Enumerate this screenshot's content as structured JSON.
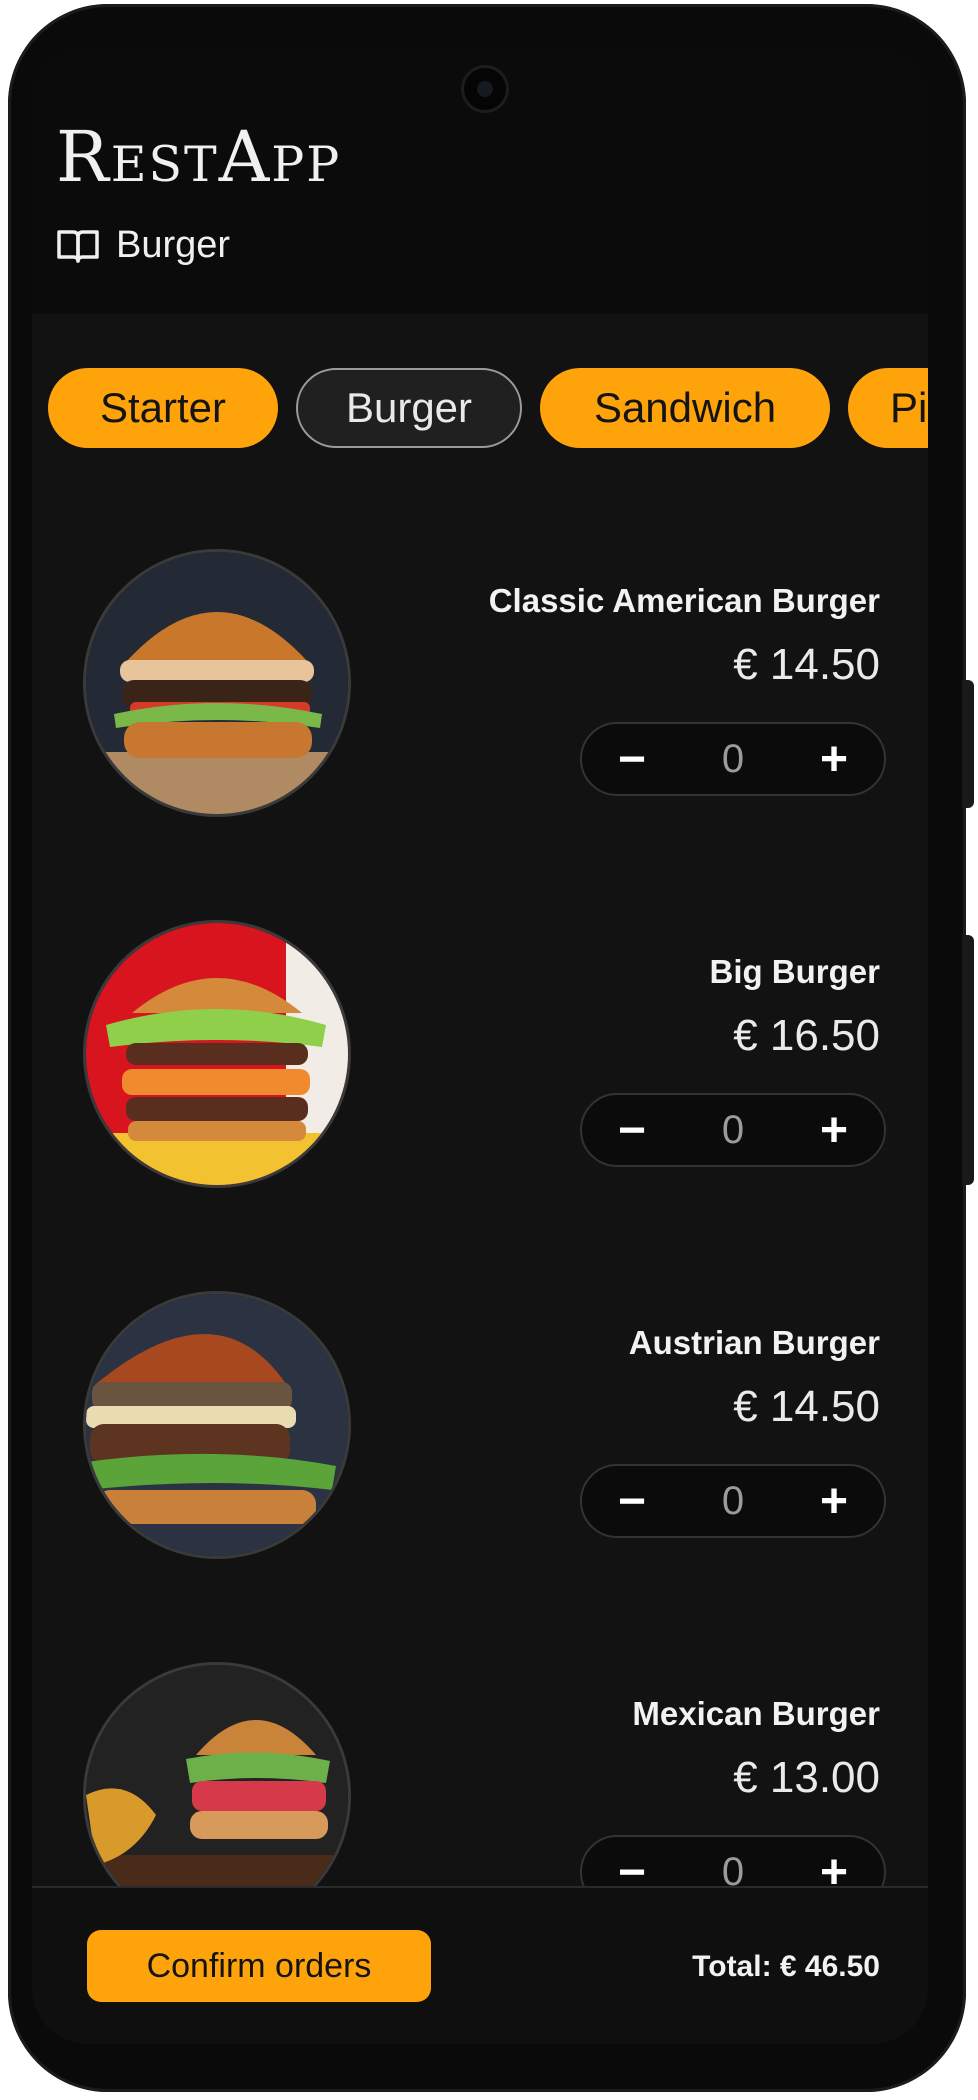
{
  "app": {
    "title": "RestApp"
  },
  "header": {
    "section_icon": "book-icon",
    "section_name": "Burger"
  },
  "categories": [
    {
      "label": "Starter",
      "active": false
    },
    {
      "label": "Burger",
      "active": true
    },
    {
      "label": "Sandwich",
      "active": false
    },
    {
      "label": "Pi",
      "active": false
    }
  ],
  "items": [
    {
      "name": "Classic American Burger",
      "price": "€ 14.50",
      "quantity": "0",
      "minus": "−",
      "plus": "+"
    },
    {
      "name": "Big Burger",
      "price": "€ 16.50",
      "quantity": "0",
      "minus": "−",
      "plus": "+"
    },
    {
      "name": "Austrian Burger",
      "price": "€ 14.50",
      "quantity": "0",
      "minus": "−",
      "plus": "+"
    },
    {
      "name": "Mexican Burger",
      "price": "€ 13.00",
      "quantity": "0",
      "minus": "−",
      "plus": "+"
    }
  ],
  "footer": {
    "confirm_label": "Confirm orders",
    "total": "Total: € 46.50"
  },
  "colors": {
    "accent": "#ffa30a",
    "background": "#121212",
    "header": "#0b0b0b"
  }
}
